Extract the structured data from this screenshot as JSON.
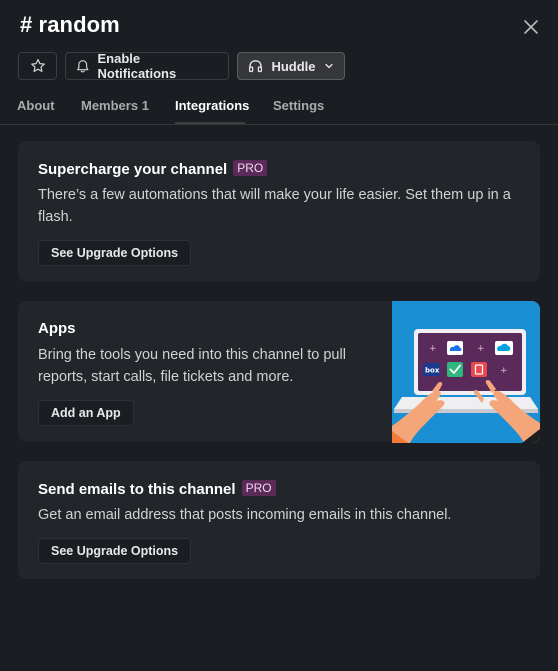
{
  "header": {
    "title": "# random"
  },
  "actions": {
    "star_icon": "star-icon",
    "notifications_label": "Enable Notifications",
    "huddle_label": "Huddle"
  },
  "tabs": [
    {
      "label": "About"
    },
    {
      "label": "Members 1"
    },
    {
      "label": "Integrations"
    },
    {
      "label": "Settings"
    }
  ],
  "cards": {
    "supercharge": {
      "title": "Supercharge your channel",
      "badge": "PRO",
      "description": "There’s a few automations that will make your life easier. Set them up in a flash.",
      "button": "See Upgrade Options"
    },
    "apps": {
      "title": "Apps",
      "description": "Bring the tools you need into this channel to pull reports, start calls, file tickets and more.",
      "button": "Add an App"
    },
    "emails": {
      "title": "Send emails to this channel",
      "badge": "PRO",
      "description": "Get an email address that posts incoming emails in this channel.",
      "button": "See Upgrade Options"
    }
  },
  "colors": {
    "background": "#1a1d21",
    "card": "#222529",
    "pro_badge": "#5b2a59",
    "illustration_bg": "#1a8fd4"
  }
}
